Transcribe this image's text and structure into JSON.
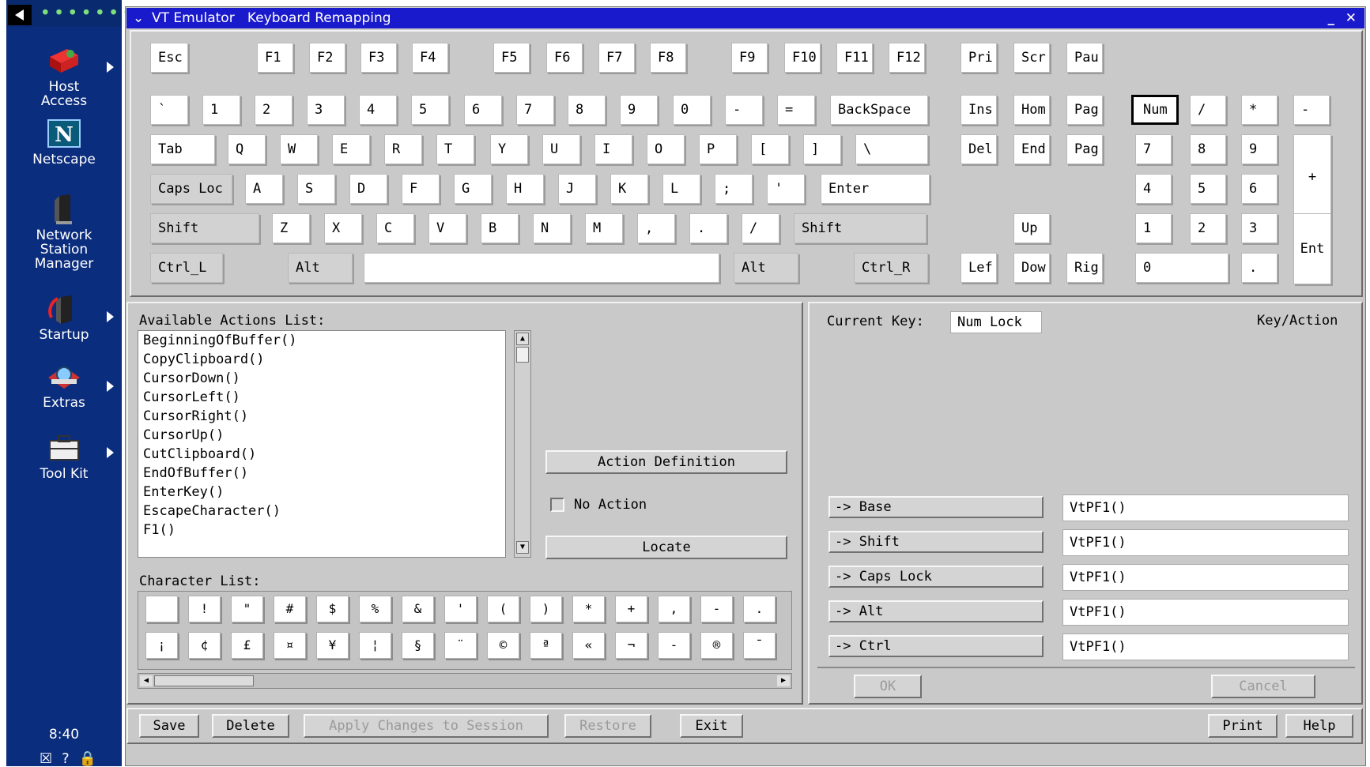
{
  "launcher": {
    "items": [
      {
        "label1": "Host",
        "label2": "Access",
        "icon": "host-access-icon"
      },
      {
        "label1": "Netscape",
        "label2": "",
        "icon": "netscape-icon"
      },
      {
        "label1": "Network",
        "label2": "Station",
        "label3": "Manager",
        "icon": "network-station-icon"
      },
      {
        "label1": "Startup",
        "label2": "",
        "icon": "startup-icon"
      },
      {
        "label1": "Extras",
        "label2": "",
        "icon": "extras-icon"
      },
      {
        "label1": "Tool Kit",
        "label2": "",
        "icon": "toolkit-icon"
      }
    ],
    "clock": "8:40",
    "bottom_icons": "☒?🔒"
  },
  "window": {
    "menu_glyph": "⌄",
    "title": "VT Emulator   Keyboard Remapping",
    "min": "_",
    "close": "✕"
  },
  "keyboard": {
    "row0": [
      "Esc",
      "F1",
      "F2",
      "F3",
      "F4",
      "F5",
      "F6",
      "F7",
      "F8",
      "F9",
      "F10",
      "F11",
      "F12",
      "Pri",
      "Scr",
      "Pau"
    ],
    "row1": [
      "`",
      "1",
      "2",
      "3",
      "4",
      "5",
      "6",
      "7",
      "8",
      "9",
      "0",
      "-",
      "=",
      "BackSpace",
      "Ins",
      "Hom",
      "Pag",
      "Num",
      "/",
      "*",
      "-"
    ],
    "row2": [
      "Tab",
      "Q",
      "W",
      "E",
      "R",
      "T",
      "Y",
      "U",
      "I",
      "O",
      "P",
      "[",
      "]",
      "\\",
      "Del",
      "End",
      "Pag",
      "7",
      "8",
      "9",
      "+"
    ],
    "row3": [
      "Caps Loc",
      "A",
      "S",
      "D",
      "F",
      "G",
      "H",
      "J",
      "K",
      "L",
      ";",
      "'",
      "Enter",
      "4",
      "5",
      "6"
    ],
    "row4": [
      "Shift",
      "Z",
      "X",
      "C",
      "V",
      "B",
      "N",
      "M",
      ",",
      ".",
      "/",
      "Shift",
      "Up",
      "1",
      "2",
      "3",
      "Ent"
    ],
    "row5": [
      "Ctrl_L",
      "Alt",
      "",
      "Alt",
      "Ctrl_R",
      "Lef",
      "Dow",
      "Rig",
      "0",
      "."
    ]
  },
  "actions": {
    "heading": "Available Actions List:",
    "items": [
      "BeginningOfBuffer()",
      "CopyClipboard()",
      "CursorDown()",
      "CursorLeft()",
      "CursorRight()",
      "CursorUp()",
      "CutClipboard()",
      "EndOfBuffer()",
      "EnterKey()",
      "EscapeCharacter()",
      "F1()"
    ],
    "action_definition": "Action Definition",
    "no_action": "No Action",
    "locate": "Locate"
  },
  "characters": {
    "heading": "Character List:",
    "row1": [
      " ",
      "!",
      "\"",
      "#",
      "$",
      "%",
      "&",
      "'",
      "(",
      ")",
      "*",
      "+",
      ",",
      "-",
      "."
    ],
    "row2": [
      "¡",
      "¢",
      "£",
      "¤",
      "¥",
      "¦",
      "§",
      "¨",
      "©",
      "ª",
      "«",
      "¬",
      "-",
      "®",
      "¯"
    ]
  },
  "current": {
    "label": "Current Key:",
    "key": "Num Lock",
    "header": "Key/Action",
    "mappings": [
      {
        "button": "-> Base",
        "value": "VtPF1()"
      },
      {
        "button": "-> Shift",
        "value": "VtPF1()"
      },
      {
        "button": "-> Caps Lock",
        "value": "VtPF1()"
      },
      {
        "button": "-> Alt",
        "value": "VtPF1()"
      },
      {
        "button": "-> Ctrl",
        "value": "VtPF1()"
      }
    ],
    "ok": "OK",
    "cancel": "Cancel"
  },
  "footer": {
    "save": "Save",
    "delete": "Delete",
    "apply": "Apply Changes to Session",
    "restore": "Restore",
    "exit": "Exit",
    "print": "Print",
    "help": "Help"
  }
}
